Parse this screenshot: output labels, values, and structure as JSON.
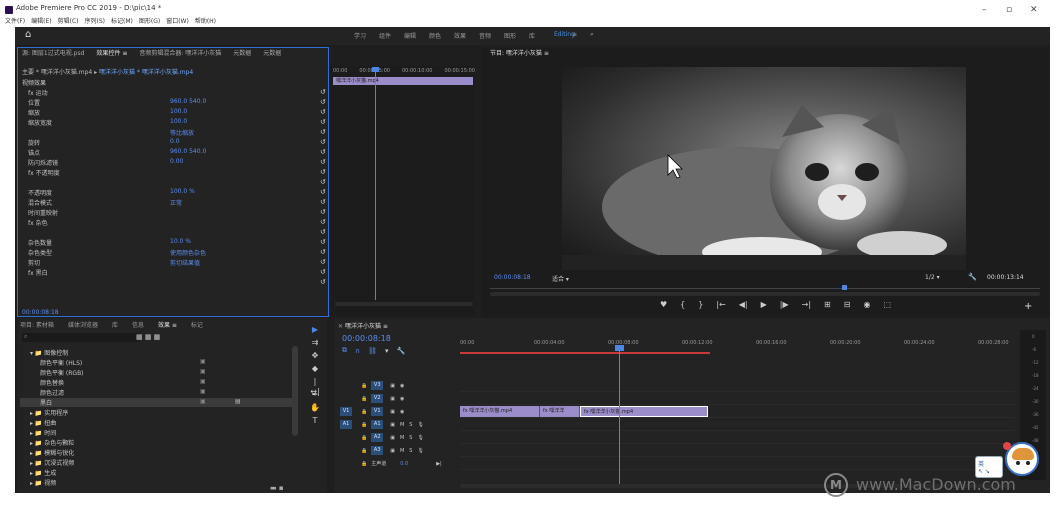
{
  "window": {
    "title": "Adobe Premiere Pro CC 2019 - D:\\pic\\14 *",
    "menu": [
      "文件(F)",
      "编辑(E)",
      "剪辑(C)",
      "序列(S)",
      "标记(M)",
      "图形(G)",
      "窗口(W)",
      "帮助(H)"
    ]
  },
  "workspaces": {
    "tabs": [
      "学习",
      "组件",
      "编辑",
      "颜色",
      "效果",
      "音频",
      "图形",
      "库",
      "Editing",
      "≡",
      "»"
    ],
    "active_index": 8
  },
  "effect_controls": {
    "tabs": [
      "源: 图层1过式电视.psd",
      "效果控件 ≡",
      "音频剪辑混合器: 嘿洋洋小灰猫",
      "元数据",
      "元数据"
    ],
    "clip_label": "主要 * 嘿洋洋小灰猫.mp4",
    "clip_sequence": "嘿洋洋小灰猫 * 嘿洋洋小灰猫.mp4",
    "timecodes": [
      "00:00",
      "00:00:05:00",
      "00:00:10:00",
      "00:00:15:00"
    ],
    "clip_bar": "嘿洋洋小灰猫.mp4",
    "section_video": "视频效果",
    "rows": [
      {
        "label": "fx 运动",
        "value": ""
      },
      {
        "label": "位置",
        "value": "960.0  540.0"
      },
      {
        "label": "缩放",
        "value": "100.0"
      },
      {
        "label": "缩放宽度",
        "value": "100.0"
      },
      {
        "label": "",
        "value": "等比缩放"
      },
      {
        "label": "旋转",
        "value": "0.0"
      },
      {
        "label": "锚点",
        "value": "960.0  540.0"
      },
      {
        "label": "防闪烁滤镜",
        "value": "0.00"
      },
      {
        "label": "fx 不透明度",
        "value": ""
      },
      {
        "label": "",
        "value": ""
      },
      {
        "label": "不透明度",
        "value": "100.0 %"
      },
      {
        "label": "混合模式",
        "value": "正常"
      },
      {
        "label": "时间重映射",
        "value": ""
      },
      {
        "label": "fx 杂色",
        "value": ""
      },
      {
        "label": "",
        "value": ""
      },
      {
        "label": "杂色数量",
        "value": "10.0 %"
      },
      {
        "label": "杂色类型",
        "value": "使用颜色杂色"
      },
      {
        "label": "剪切",
        "value": "剪切结果值"
      },
      {
        "label": "fx 黑白",
        "value": ""
      },
      {
        "label": "",
        "value": ""
      }
    ],
    "footer_tc": "00:00:08:18"
  },
  "program_monitor": {
    "tab": "节目: 嘿洋洋小灰猫 ≡",
    "timecode_left": "00:00:08:18",
    "fit": "适合",
    "fraction": "1/2",
    "timecode_right": "00:00:13:14",
    "controls": [
      "♥",
      "{",
      "}",
      "|←",
      "◀|",
      "▶",
      "|▶",
      "→|",
      "⊞",
      "⊟",
      "◉",
      "⬚"
    ],
    "playhead_fraction": 0.64
  },
  "effects_panel": {
    "tabs": [
      "项目: 素材箱",
      "媒体浏览器",
      "库",
      "信息",
      "效果 ≡",
      "标记"
    ],
    "items": [
      {
        "label": "▾ 📁 图像控制",
        "indent": 1
      },
      {
        "label": "颜色平衡 (HLS)",
        "indent": 2
      },
      {
        "label": "颜色平衡 (RGB)",
        "indent": 2
      },
      {
        "label": "颜色替换",
        "indent": 2
      },
      {
        "label": "颜色过滤",
        "indent": 2
      },
      {
        "label": "黑白",
        "indent": 2,
        "selected": true
      },
      {
        "label": "▸ 📁 实用程序",
        "indent": 1
      },
      {
        "label": "▸ 📁 扭曲",
        "indent": 1
      },
      {
        "label": "▸ 📁 时间",
        "indent": 1
      },
      {
        "label": "▸ 📁 杂色与颗粒",
        "indent": 1
      },
      {
        "label": "▸ 📁 模糊与锐化",
        "indent": 1
      },
      {
        "label": "▸ 📁 沉浸式视频",
        "indent": 1
      },
      {
        "label": "▸ 📁 生成",
        "indent": 1
      },
      {
        "label": "▸ 📁 视频",
        "indent": 1
      }
    ]
  },
  "timeline": {
    "tab": "嘿洋洋小灰猫 ≡",
    "timecode": "00:00:08:18",
    "ruler": [
      "00:00",
      "00:00:04:00",
      "00:00:08:00",
      "00:00:12:00",
      "00:00:16:00",
      "00:00:20:00",
      "00:00:24:00",
      "00:00:28:00"
    ],
    "tracks": [
      {
        "name": "V3",
        "type": "video"
      },
      {
        "name": "V2",
        "type": "video"
      },
      {
        "name": "V1",
        "type": "video",
        "target": "V1"
      },
      {
        "name": "A1",
        "type": "audio",
        "target": "A1"
      },
      {
        "name": "A2",
        "type": "audio"
      },
      {
        "name": "A3",
        "type": "audio"
      },
      {
        "name": "主声道",
        "type": "master",
        "value": "0.0"
      }
    ],
    "clips": [
      {
        "label": "fx 嘿洋洋小灰猫.mp4"
      },
      {
        "label": "fx 嘿洋洋"
      },
      {
        "label": "fx 嘿洋洋小灰猫.mp4"
      }
    ],
    "meter_labels": [
      "0",
      "-6",
      "-12",
      "-18",
      "-24",
      "-30",
      "-36",
      "-42",
      "-48",
      "-54",
      "dB"
    ]
  },
  "watermark": {
    "text": "www.MacDown.com",
    "logo": "M"
  },
  "mascot": {
    "bubble": "英"
  }
}
